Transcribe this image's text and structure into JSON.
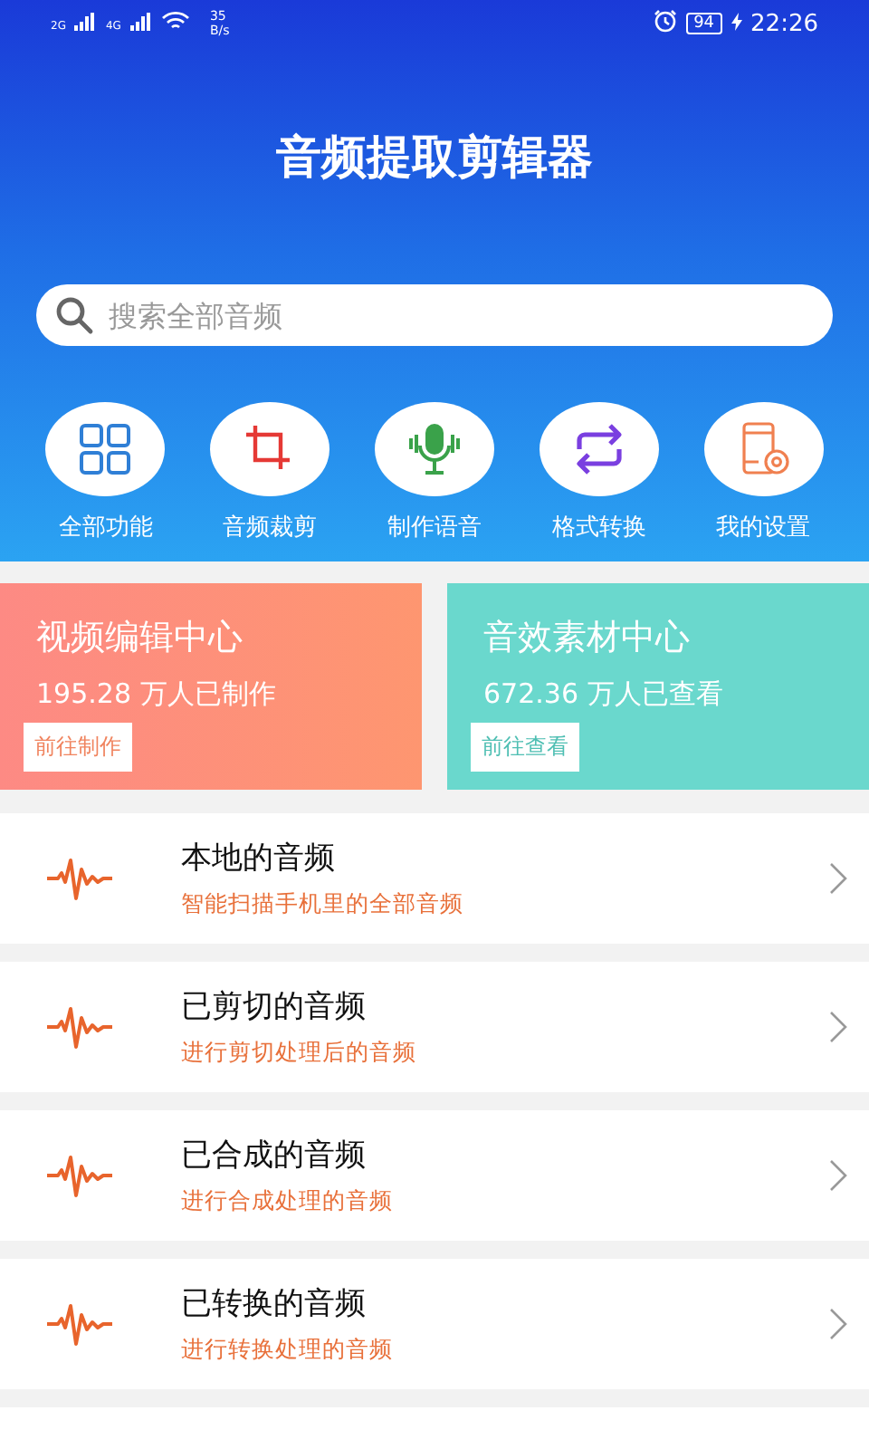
{
  "status_bar": {
    "network_1": "2G",
    "network_2": "4G",
    "speed_value": "35",
    "speed_unit": "B/s",
    "battery": "94",
    "time": "22:26"
  },
  "title": "音频提取剪辑器",
  "search": {
    "placeholder": "搜索全部音频"
  },
  "tools": [
    {
      "kind": "grid",
      "label": "全部功能"
    },
    {
      "kind": "crop",
      "label": "音频裁剪"
    },
    {
      "kind": "mic",
      "label": "制作语音"
    },
    {
      "kind": "convert",
      "label": "格式转换"
    },
    {
      "kind": "settings",
      "label": "我的设置"
    }
  ],
  "promos": [
    {
      "kind": "video",
      "title": "视频编辑中心",
      "stat": "195.28 万人已制作",
      "action": "前往制作"
    },
    {
      "kind": "sound",
      "title": "音效素材中心",
      "stat": "672.36 万人已查看",
      "action": "前往查看"
    }
  ],
  "audio_lists": [
    {
      "title": "本地的音频",
      "subtitle": "智能扫描手机里的全部音频"
    },
    {
      "title": "已剪切的音频",
      "subtitle": "进行剪切处理后的音频"
    },
    {
      "title": "已合成的音频",
      "subtitle": "进行合成处理的音频"
    },
    {
      "title": "已转换的音频",
      "subtitle": "进行转换处理的音频"
    }
  ]
}
